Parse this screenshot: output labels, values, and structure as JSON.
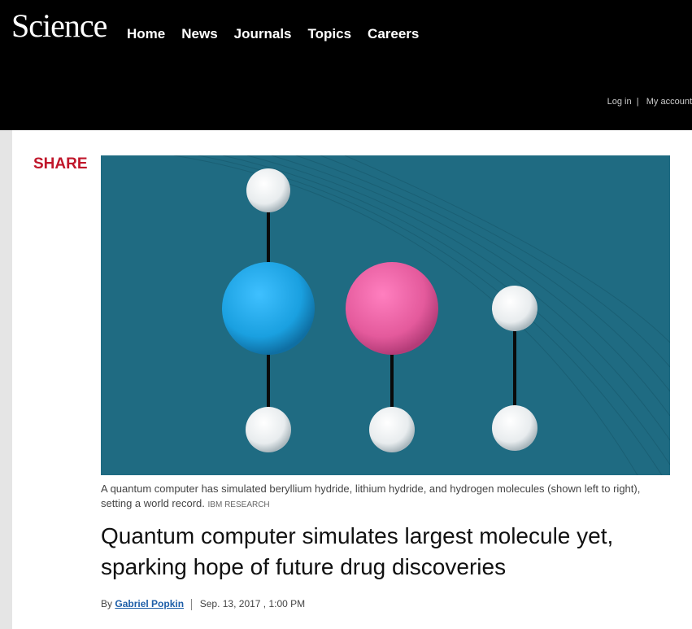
{
  "header": {
    "logo": "Science",
    "nav": [
      "Home",
      "News",
      "Journals",
      "Topics",
      "Careers"
    ],
    "login": "Log in",
    "account": "My account"
  },
  "share_label": "SHARE",
  "hero": {
    "caption": "A quantum computer has simulated beryllium hydride, lithium hydride, and hydrogen molecules (shown left to right), setting a world record.",
    "credit": "IBM RESEARCH"
  },
  "article": {
    "headline": "Quantum computer simulates largest molecule yet, sparking hope of future drug discoveries",
    "by": "By",
    "author": "Gabriel Popkin",
    "date": "Sep. 13, 2017 , 1:00 PM"
  },
  "colors": {
    "hero_background": "#1f6b82",
    "brand_red": "#c0172b",
    "author_link": "#1d5ea8",
    "beryllium_atom": "#1aa0e0",
    "lithium_atom": "#e45a9c",
    "hydrogen_atom": "#ffffff"
  }
}
